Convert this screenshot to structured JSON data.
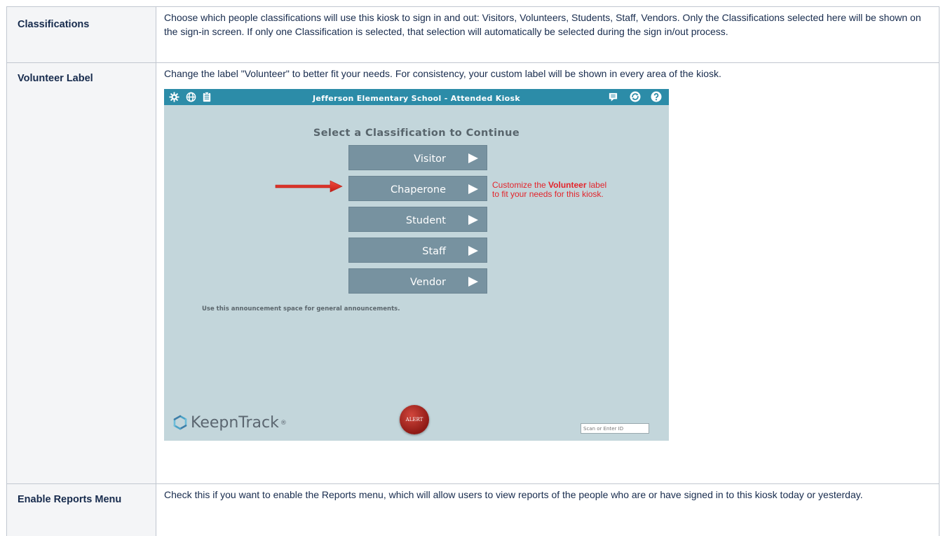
{
  "rows": [
    {
      "heading": "Classifications",
      "description": "Choose which people classifications will use this kiosk to sign in and out: Visitors, Volunteers, Students, Staff, Vendors. Only the Classifications selected here will be shown on the sign-in screen. If only one Classification is selected, that selection will automatically be selected during the sign in/out process."
    },
    {
      "heading": "Volunteer Label",
      "description": "Change the label \"Volunteer\" to better fit your needs. For consistency, your custom label will be shown in every area of the kiosk."
    },
    {
      "heading": "Enable Reports Menu",
      "description": "Check this if you want to enable the Reports menu, which will allow users to view reports of the people who are or have signed in to this kiosk today or yesterday."
    }
  ],
  "kiosk": {
    "title": "Jefferson Elementary School - Attended Kiosk",
    "heading": "Select a Classification to Continue",
    "buttons": [
      "Visitor",
      "Chaperone",
      "Student",
      "Staff",
      "Vendor"
    ],
    "annotation_pre": "Customize the ",
    "annotation_bold": "Volunteer",
    "annotation_post": " label",
    "annotation_line2": "to fit your needs for this kiosk.",
    "announcement": "Use this announcement space for general announcements.",
    "logo_text": "KeepnTrack",
    "logo_mark": "®",
    "alert_label": "ALERT",
    "scan_placeholder": "Scan or Enter ID",
    "colors": {
      "bar": "#2c8ca8",
      "background": "#c3d6db",
      "button": "#7792a0",
      "annotation": "#e3242b"
    },
    "icons": [
      "gear-icon",
      "globe-icon",
      "clipboard-icon",
      "message-icon",
      "refresh-icon",
      "help-icon"
    ]
  }
}
